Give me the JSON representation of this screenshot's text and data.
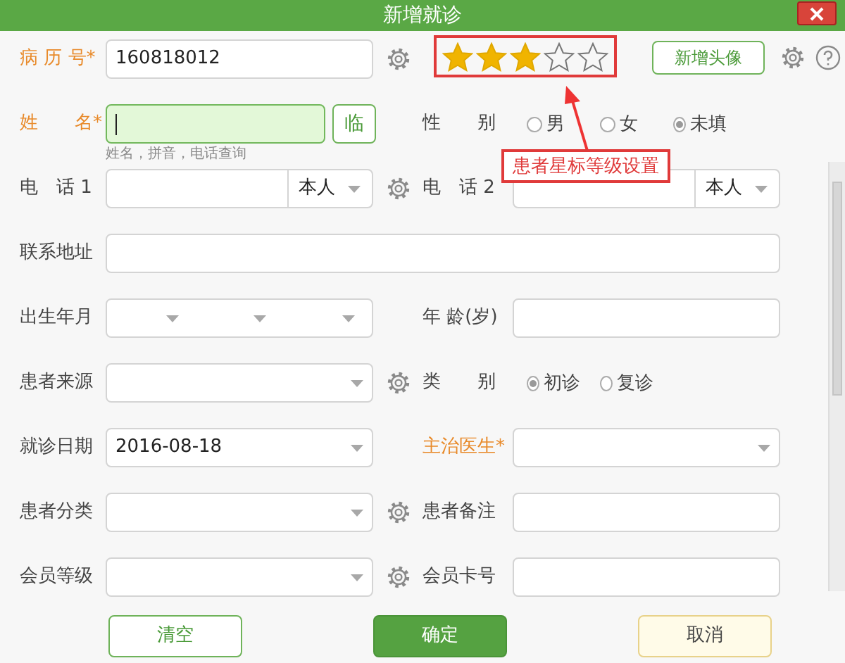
{
  "window": {
    "title": "新增就诊"
  },
  "header": {
    "record_label": "病 历 号*",
    "record_required": true,
    "record_value": "160818012",
    "record_gear": true,
    "stars": 3,
    "avatar_button": "新增头像"
  },
  "annotation": {
    "text": "患者星标等级设置"
  },
  "rows": [
    {
      "left": {
        "kind": "name",
        "label": "姓　　名*",
        "required": true,
        "focused": true,
        "hint": "姓名，拼音，电话查询",
        "side_button": "临"
      },
      "right": {
        "kind": "radio",
        "label": "性　　别",
        "required": false,
        "options": [
          {
            "label": "男",
            "selected": false
          },
          {
            "label": "女",
            "selected": false
          },
          {
            "label": "未填",
            "selected": true
          }
        ]
      }
    },
    {
      "left": {
        "kind": "phone",
        "label": "电　话 1",
        "required": false,
        "relation": "本人",
        "gear": true
      },
      "right": {
        "kind": "phone",
        "label": "电　话 2",
        "required": false,
        "relation": "本人"
      }
    },
    {
      "left": {
        "kind": "wide",
        "label": "联系地址",
        "required": false
      }
    },
    {
      "left": {
        "kind": "date3",
        "label": "出生年月",
        "required": false
      },
      "right": {
        "kind": "input",
        "label": "年 龄(岁)",
        "required": false
      }
    },
    {
      "left": {
        "kind": "select",
        "label": "患者来源",
        "required": false,
        "gear": true
      },
      "right": {
        "kind": "radio",
        "label": "类　　别",
        "required": false,
        "options": [
          {
            "label": "初诊",
            "selected": true
          },
          {
            "label": "复诊",
            "selected": false
          }
        ]
      }
    },
    {
      "left": {
        "kind": "select",
        "label": "就诊日期",
        "required": false,
        "value": "2016-08-18"
      },
      "right": {
        "kind": "select",
        "label": "主治医生*",
        "required": true
      }
    },
    {
      "left": {
        "kind": "select",
        "label": "患者分类",
        "required": false,
        "gear": true
      },
      "right": {
        "kind": "input",
        "label": "患者备注",
        "required": false
      }
    },
    {
      "left": {
        "kind": "select",
        "label": "会员等级",
        "required": false,
        "gear": true
      },
      "right": {
        "kind": "input",
        "label": "会员卡号",
        "required": false
      }
    }
  ],
  "buttons": [
    {
      "label": "清空",
      "kind": "outline"
    },
    {
      "label": "确定",
      "kind": "primary"
    },
    {
      "label": "取消",
      "kind": "cancel"
    }
  ]
}
